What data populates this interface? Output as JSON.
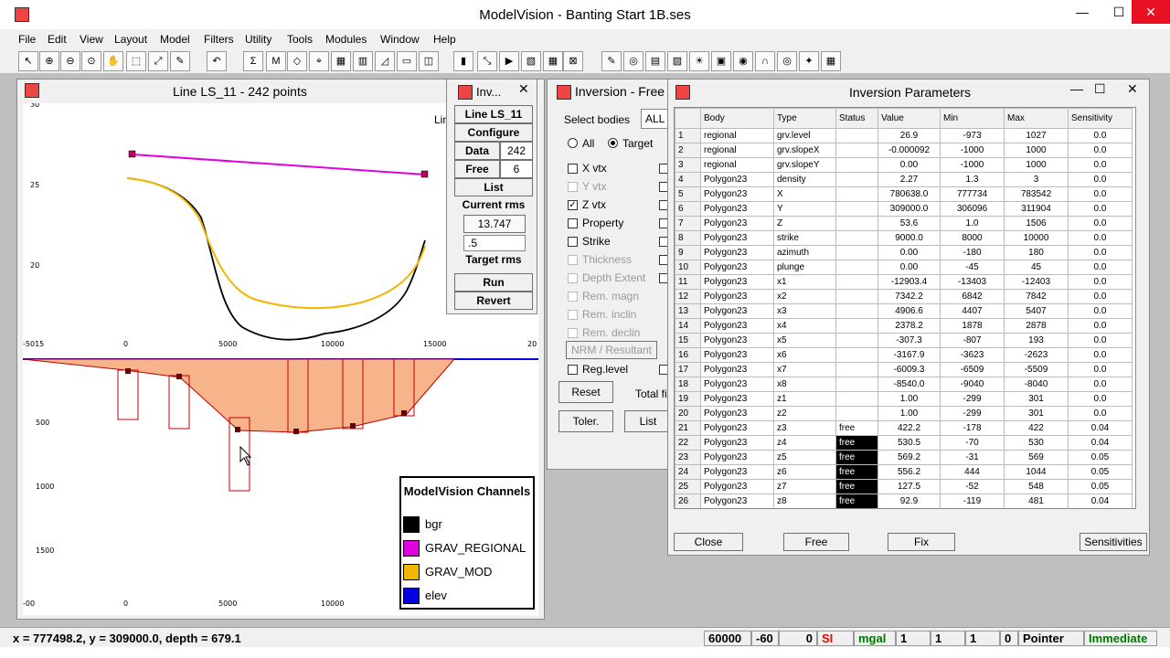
{
  "app": {
    "title": "ModelVision - Banting Start 1B.ses"
  },
  "menu": [
    "File",
    "Edit",
    "View",
    "Layout",
    "Model",
    "Filters",
    "Utility",
    "Tools",
    "Modules",
    "Window",
    "Help"
  ],
  "line_window": {
    "title": "Line LS_11 - 242 points",
    "top_y_ticks": [
      "30",
      "25",
      "20"
    ],
    "x_ticks": [
      "-5015",
      "0",
      "5000",
      "10000",
      "15000",
      "20"
    ],
    "depth_ticks": [
      "500",
      "1000",
      "1500"
    ],
    "bottom_x_ticks": [
      "-00",
      "0",
      "5000",
      "10000"
    ],
    "partial_label": "Lin",
    "legend": {
      "title": "ModelVision Channels",
      "items": [
        {
          "name": "bgr",
          "color": "#000000"
        },
        {
          "name": "GRAV_REGIONAL",
          "color": "#e000e0"
        },
        {
          "name": "GRAV_MOD",
          "color": "#f2b600"
        },
        {
          "name": "elev",
          "color": "#0000e0"
        }
      ]
    }
  },
  "inv_small": {
    "title": "Inv...",
    "line_btn": "Line LS_11",
    "configure_btn": "Configure",
    "data_label": "Data",
    "data_value": "242",
    "free_label": "Free",
    "free_value": "6",
    "list_btn": "List",
    "current_rms_label": "Current rms",
    "current_rms_value": "13.747",
    "target_input": ".5",
    "target_rms_label": "Target rms",
    "run_btn": "Run",
    "revert_btn": "Revert"
  },
  "inv_free": {
    "title": "Inversion - Free",
    "select_bodies_label": "Select bodies",
    "select_value": "ALL",
    "radio_all": "All",
    "radio_target": "Target",
    "checks": [
      {
        "label": "X vtx",
        "checked": false,
        "disabled": false
      },
      {
        "label": "Y vtx",
        "checked": false,
        "disabled": true
      },
      {
        "label": "Z vtx",
        "checked": true,
        "disabled": false
      },
      {
        "label": "Property",
        "checked": false,
        "disabled": false
      },
      {
        "label": "Strike",
        "checked": false,
        "disabled": false
      },
      {
        "label": "Thickness",
        "checked": false,
        "disabled": true
      },
      {
        "label": "Depth Extent",
        "checked": false,
        "disabled": true
      },
      {
        "label": "Rem. magn",
        "checked": false,
        "disabled": true
      },
      {
        "label": "Rem. inclin",
        "checked": false,
        "disabled": true
      },
      {
        "label": "Rem. declin",
        "checked": false,
        "disabled": true
      }
    ],
    "nrm_btn": "NRM / Resultant",
    "reg_level": "Reg.level",
    "reset_btn": "Reset",
    "total_label": "Total fi",
    "toler_btn": "Toler.",
    "list_btn": "List"
  },
  "inv_params": {
    "title": "Inversion Parameters",
    "columns": [
      "Body",
      "Type",
      "Status",
      "Value",
      "Min",
      "Max",
      "Sensitivity"
    ],
    "rows": [
      [
        "1",
        "regional",
        "grv.level",
        "",
        "26.9",
        "-973",
        "1027",
        "0.0"
      ],
      [
        "2",
        "regional",
        "grv.slopeX",
        "",
        "-0.000092",
        "-1000",
        "1000",
        "0.0"
      ],
      [
        "3",
        "regional",
        "grv.slopeY",
        "",
        "0.00",
        "-1000",
        "1000",
        "0.0"
      ],
      [
        "4",
        "Polygon23",
        "density",
        "",
        "2.27",
        "1.3",
        "3",
        "0.0"
      ],
      [
        "5",
        "Polygon23",
        "X",
        "",
        "780638.0",
        "777734",
        "783542",
        "0.0"
      ],
      [
        "6",
        "Polygon23",
        "Y",
        "",
        "309000.0",
        "306096",
        "311904",
        "0.0"
      ],
      [
        "7",
        "Polygon23",
        "Z",
        "",
        "53.6",
        "1.0",
        "1506",
        "0.0"
      ],
      [
        "8",
        "Polygon23",
        "strike",
        "",
        "9000.0",
        "8000",
        "10000",
        "0.0"
      ],
      [
        "9",
        "Polygon23",
        "azimuth",
        "",
        "0.00",
        "-180",
        "180",
        "0.0"
      ],
      [
        "10",
        "Polygon23",
        "plunge",
        "",
        "0.00",
        "-45",
        "45",
        "0.0"
      ],
      [
        "11",
        "Polygon23",
        "x1",
        "",
        "-12903.4",
        "-13403",
        "-12403",
        "0.0"
      ],
      [
        "12",
        "Polygon23",
        "x2",
        "",
        "7342.2",
        "6842",
        "7842",
        "0.0"
      ],
      [
        "13",
        "Polygon23",
        "x3",
        "",
        "4906.6",
        "4407",
        "5407",
        "0.0"
      ],
      [
        "14",
        "Polygon23",
        "x4",
        "",
        "2378.2",
        "1878",
        "2878",
        "0.0"
      ],
      [
        "15",
        "Polygon23",
        "x5",
        "",
        "-307.3",
        "-807",
        "193",
        "0.0"
      ],
      [
        "16",
        "Polygon23",
        "x6",
        "",
        "-3167.9",
        "-3623",
        "-2623",
        "0.0"
      ],
      [
        "17",
        "Polygon23",
        "x7",
        "",
        "-6009.3",
        "-6509",
        "-5509",
        "0.0"
      ],
      [
        "18",
        "Polygon23",
        "x8",
        "",
        "-8540.0",
        "-9040",
        "-8040",
        "0.0"
      ],
      [
        "19",
        "Polygon23",
        "z1",
        "",
        "1.00",
        "-299",
        "301",
        "0.0"
      ],
      [
        "20",
        "Polygon23",
        "z2",
        "",
        "1.00",
        "-299",
        "301",
        "0.0"
      ],
      [
        "21",
        "Polygon23",
        "z3",
        "free",
        "422.2",
        "-178",
        "422",
        "0.04"
      ],
      [
        "22",
        "Polygon23",
        "z4",
        "free",
        "530.5",
        "-70",
        "530",
        "0.04"
      ],
      [
        "23",
        "Polygon23",
        "z5",
        "free",
        "569.2",
        "-31",
        "569",
        "0.05"
      ],
      [
        "24",
        "Polygon23",
        "z6",
        "free",
        "556.2",
        "444",
        "1044",
        "0.05"
      ],
      [
        "25",
        "Polygon23",
        "z7",
        "free",
        "127.5",
        "-52",
        "548",
        "0.05"
      ],
      [
        "26",
        "Polygon23",
        "z8",
        "free",
        "92.9",
        "-119",
        "481",
        "0.04"
      ]
    ],
    "close_btn": "Close",
    "free_btn": "Free",
    "fix_btn": "Fix",
    "sens_btn": "Sensitivities"
  },
  "status": {
    "coords": "x = 777498.2, y = 309000.0, depth = 679.1",
    "f1": "60000",
    "f2": "-60",
    "f3": "0",
    "si": "SI",
    "unit": "mgal",
    "f4": "1",
    "f5": "1",
    "f6": "1",
    "f7": "0",
    "mode": "Pointer",
    "immediate": "Immediate"
  }
}
